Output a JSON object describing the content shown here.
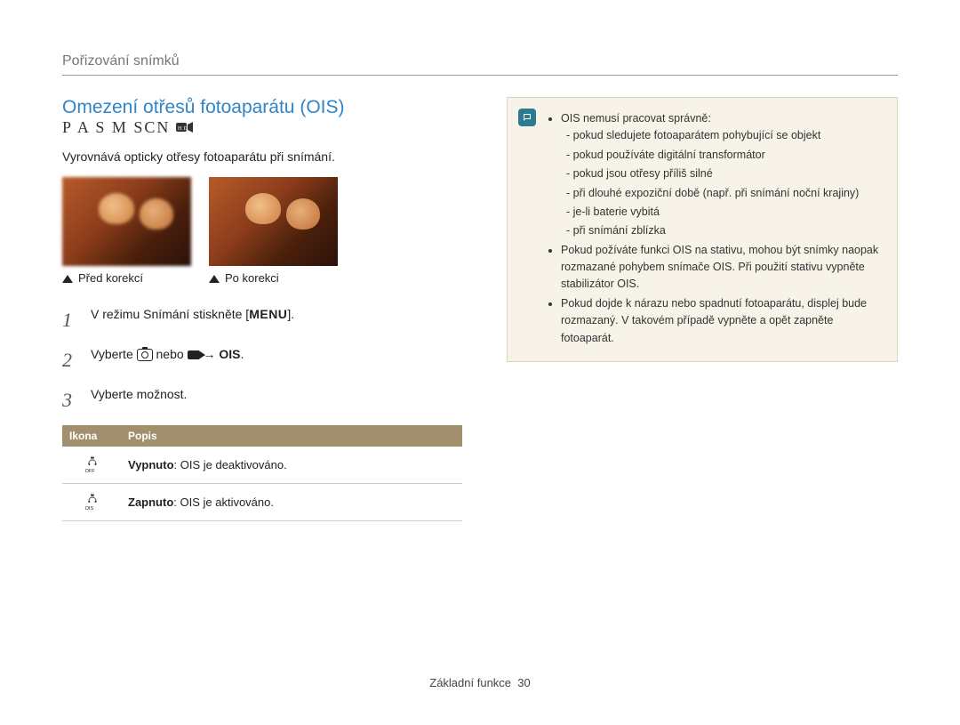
{
  "breadcrumb": "Pořizování snímků",
  "title": "Omezení otřesů fotoaparátu (OIS)",
  "mode_letters": "P A S M SCN",
  "subtitle": "Vyrovnává opticky otřesy fotoaparátu při snímání.",
  "captions": {
    "before": "Před korekcí",
    "after": "Po korekci"
  },
  "steps": {
    "n1": "1",
    "s1_pre": "V režimu Snímání stiskněte [",
    "s1_menu": "MENU",
    "s1_post": "].",
    "n2": "2",
    "s2_pre": "Vyberte ",
    "s2_mid": " nebo ",
    "s2_arrow": " → ",
    "s2_ois": "OIS",
    "s2_post": ".",
    "n3": "3",
    "s3": "Vyberte možnost."
  },
  "options_table": {
    "header_icon": "Ikona",
    "header_desc": "Popis",
    "row_off_bold": "Vypnuto",
    "row_off_rest": ": OIS je deaktivováno.",
    "row_on_bold": "Zapnuto",
    "row_on_rest": ": OIS je aktivováno."
  },
  "notes": {
    "n0": "OIS nemusí pracovat správně:",
    "n0a": "pokud sledujete fotoaparátem pohybující se objekt",
    "n0b": "pokud používáte digitální transformátor",
    "n0c": "pokud jsou otřesy příliš silné",
    "n0d": "při dlouhé expoziční době (např. při snímání noční krajiny)",
    "n0e": "je-li baterie vybitá",
    "n0f": "při snímání zblízka",
    "n1": "Pokud požíváte funkci OIS na stativu, mohou být snímky naopak rozmazané pohybem snímače OIS. Při použití stativu vypněte stabilizátor OIS.",
    "n2": "Pokud dojde k nárazu nebo spadnutí fotoaparátu, displej bude rozmazaný. V takovém případě vypněte a opět zapněte fotoaparát."
  },
  "footer_label": "Základní funkce",
  "footer_page": "30"
}
